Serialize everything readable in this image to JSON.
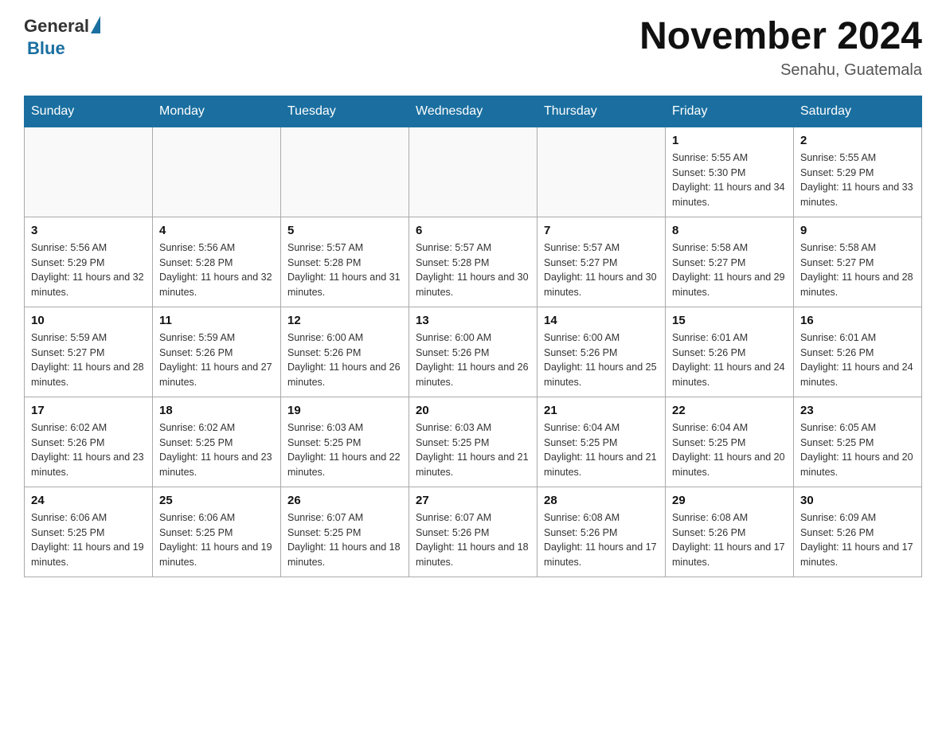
{
  "header": {
    "logo_general": "General",
    "logo_blue": "Blue",
    "month_title": "November 2024",
    "location": "Senahu, Guatemala"
  },
  "days_of_week": [
    "Sunday",
    "Monday",
    "Tuesday",
    "Wednesday",
    "Thursday",
    "Friday",
    "Saturday"
  ],
  "weeks": [
    [
      {
        "day": "",
        "info": ""
      },
      {
        "day": "",
        "info": ""
      },
      {
        "day": "",
        "info": ""
      },
      {
        "day": "",
        "info": ""
      },
      {
        "day": "",
        "info": ""
      },
      {
        "day": "1",
        "info": "Sunrise: 5:55 AM\nSunset: 5:30 PM\nDaylight: 11 hours and 34 minutes."
      },
      {
        "day": "2",
        "info": "Sunrise: 5:55 AM\nSunset: 5:29 PM\nDaylight: 11 hours and 33 minutes."
      }
    ],
    [
      {
        "day": "3",
        "info": "Sunrise: 5:56 AM\nSunset: 5:29 PM\nDaylight: 11 hours and 32 minutes."
      },
      {
        "day": "4",
        "info": "Sunrise: 5:56 AM\nSunset: 5:28 PM\nDaylight: 11 hours and 32 minutes."
      },
      {
        "day": "5",
        "info": "Sunrise: 5:57 AM\nSunset: 5:28 PM\nDaylight: 11 hours and 31 minutes."
      },
      {
        "day": "6",
        "info": "Sunrise: 5:57 AM\nSunset: 5:28 PM\nDaylight: 11 hours and 30 minutes."
      },
      {
        "day": "7",
        "info": "Sunrise: 5:57 AM\nSunset: 5:27 PM\nDaylight: 11 hours and 30 minutes."
      },
      {
        "day": "8",
        "info": "Sunrise: 5:58 AM\nSunset: 5:27 PM\nDaylight: 11 hours and 29 minutes."
      },
      {
        "day": "9",
        "info": "Sunrise: 5:58 AM\nSunset: 5:27 PM\nDaylight: 11 hours and 28 minutes."
      }
    ],
    [
      {
        "day": "10",
        "info": "Sunrise: 5:59 AM\nSunset: 5:27 PM\nDaylight: 11 hours and 28 minutes."
      },
      {
        "day": "11",
        "info": "Sunrise: 5:59 AM\nSunset: 5:26 PM\nDaylight: 11 hours and 27 minutes."
      },
      {
        "day": "12",
        "info": "Sunrise: 6:00 AM\nSunset: 5:26 PM\nDaylight: 11 hours and 26 minutes."
      },
      {
        "day": "13",
        "info": "Sunrise: 6:00 AM\nSunset: 5:26 PM\nDaylight: 11 hours and 26 minutes."
      },
      {
        "day": "14",
        "info": "Sunrise: 6:00 AM\nSunset: 5:26 PM\nDaylight: 11 hours and 25 minutes."
      },
      {
        "day": "15",
        "info": "Sunrise: 6:01 AM\nSunset: 5:26 PM\nDaylight: 11 hours and 24 minutes."
      },
      {
        "day": "16",
        "info": "Sunrise: 6:01 AM\nSunset: 5:26 PM\nDaylight: 11 hours and 24 minutes."
      }
    ],
    [
      {
        "day": "17",
        "info": "Sunrise: 6:02 AM\nSunset: 5:26 PM\nDaylight: 11 hours and 23 minutes."
      },
      {
        "day": "18",
        "info": "Sunrise: 6:02 AM\nSunset: 5:25 PM\nDaylight: 11 hours and 23 minutes."
      },
      {
        "day": "19",
        "info": "Sunrise: 6:03 AM\nSunset: 5:25 PM\nDaylight: 11 hours and 22 minutes."
      },
      {
        "day": "20",
        "info": "Sunrise: 6:03 AM\nSunset: 5:25 PM\nDaylight: 11 hours and 21 minutes."
      },
      {
        "day": "21",
        "info": "Sunrise: 6:04 AM\nSunset: 5:25 PM\nDaylight: 11 hours and 21 minutes."
      },
      {
        "day": "22",
        "info": "Sunrise: 6:04 AM\nSunset: 5:25 PM\nDaylight: 11 hours and 20 minutes."
      },
      {
        "day": "23",
        "info": "Sunrise: 6:05 AM\nSunset: 5:25 PM\nDaylight: 11 hours and 20 minutes."
      }
    ],
    [
      {
        "day": "24",
        "info": "Sunrise: 6:06 AM\nSunset: 5:25 PM\nDaylight: 11 hours and 19 minutes."
      },
      {
        "day": "25",
        "info": "Sunrise: 6:06 AM\nSunset: 5:25 PM\nDaylight: 11 hours and 19 minutes."
      },
      {
        "day": "26",
        "info": "Sunrise: 6:07 AM\nSunset: 5:25 PM\nDaylight: 11 hours and 18 minutes."
      },
      {
        "day": "27",
        "info": "Sunrise: 6:07 AM\nSunset: 5:26 PM\nDaylight: 11 hours and 18 minutes."
      },
      {
        "day": "28",
        "info": "Sunrise: 6:08 AM\nSunset: 5:26 PM\nDaylight: 11 hours and 17 minutes."
      },
      {
        "day": "29",
        "info": "Sunrise: 6:08 AM\nSunset: 5:26 PM\nDaylight: 11 hours and 17 minutes."
      },
      {
        "day": "30",
        "info": "Sunrise: 6:09 AM\nSunset: 5:26 PM\nDaylight: 11 hours and 17 minutes."
      }
    ]
  ]
}
